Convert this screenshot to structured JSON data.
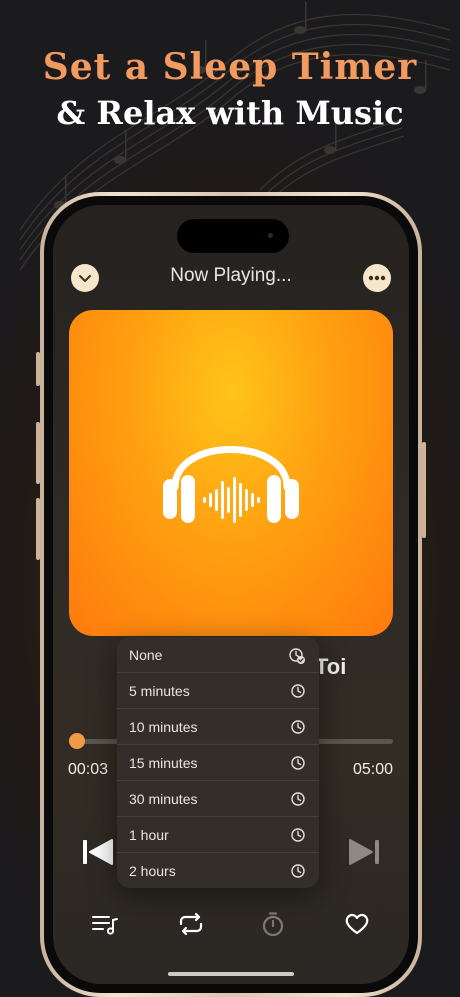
{
  "promo": {
    "line1": "Set a Sleep Timer",
    "line2": "& Relax with Music"
  },
  "header": {
    "title": "Now Playing...",
    "collapse_icon": "chevron-down-icon",
    "more_icon": "ellipsis-icon"
  },
  "track": {
    "title_visible": "Toi",
    "elapsed": "00:03",
    "duration": "05:00",
    "progress": 0.01
  },
  "sleep_timer_menu": {
    "items": [
      {
        "label": "None",
        "icon": "clock-check-icon",
        "selected": true
      },
      {
        "label": "5 minutes",
        "icon": "clock-icon"
      },
      {
        "label": "10 minutes",
        "icon": "clock-icon"
      },
      {
        "label": "15 minutes",
        "icon": "clock-icon"
      },
      {
        "label": "30 minutes",
        "icon": "clock-icon"
      },
      {
        "label": "1 hour",
        "icon": "clock-icon"
      },
      {
        "label": "2 hours",
        "icon": "clock-icon"
      }
    ]
  },
  "controls": {
    "previous_icon": "skip-previous-icon",
    "next_icon": "skip-next-icon"
  },
  "tabbar": {
    "items": [
      "playlist-icon",
      "repeat-icon",
      "timer-icon",
      "heart-icon"
    ]
  },
  "colors": {
    "accent": "#f39a48",
    "headline_accent": "#f39a5e",
    "artwork_top": "#ffc41a",
    "artwork_bottom": "#ff7a0d"
  }
}
